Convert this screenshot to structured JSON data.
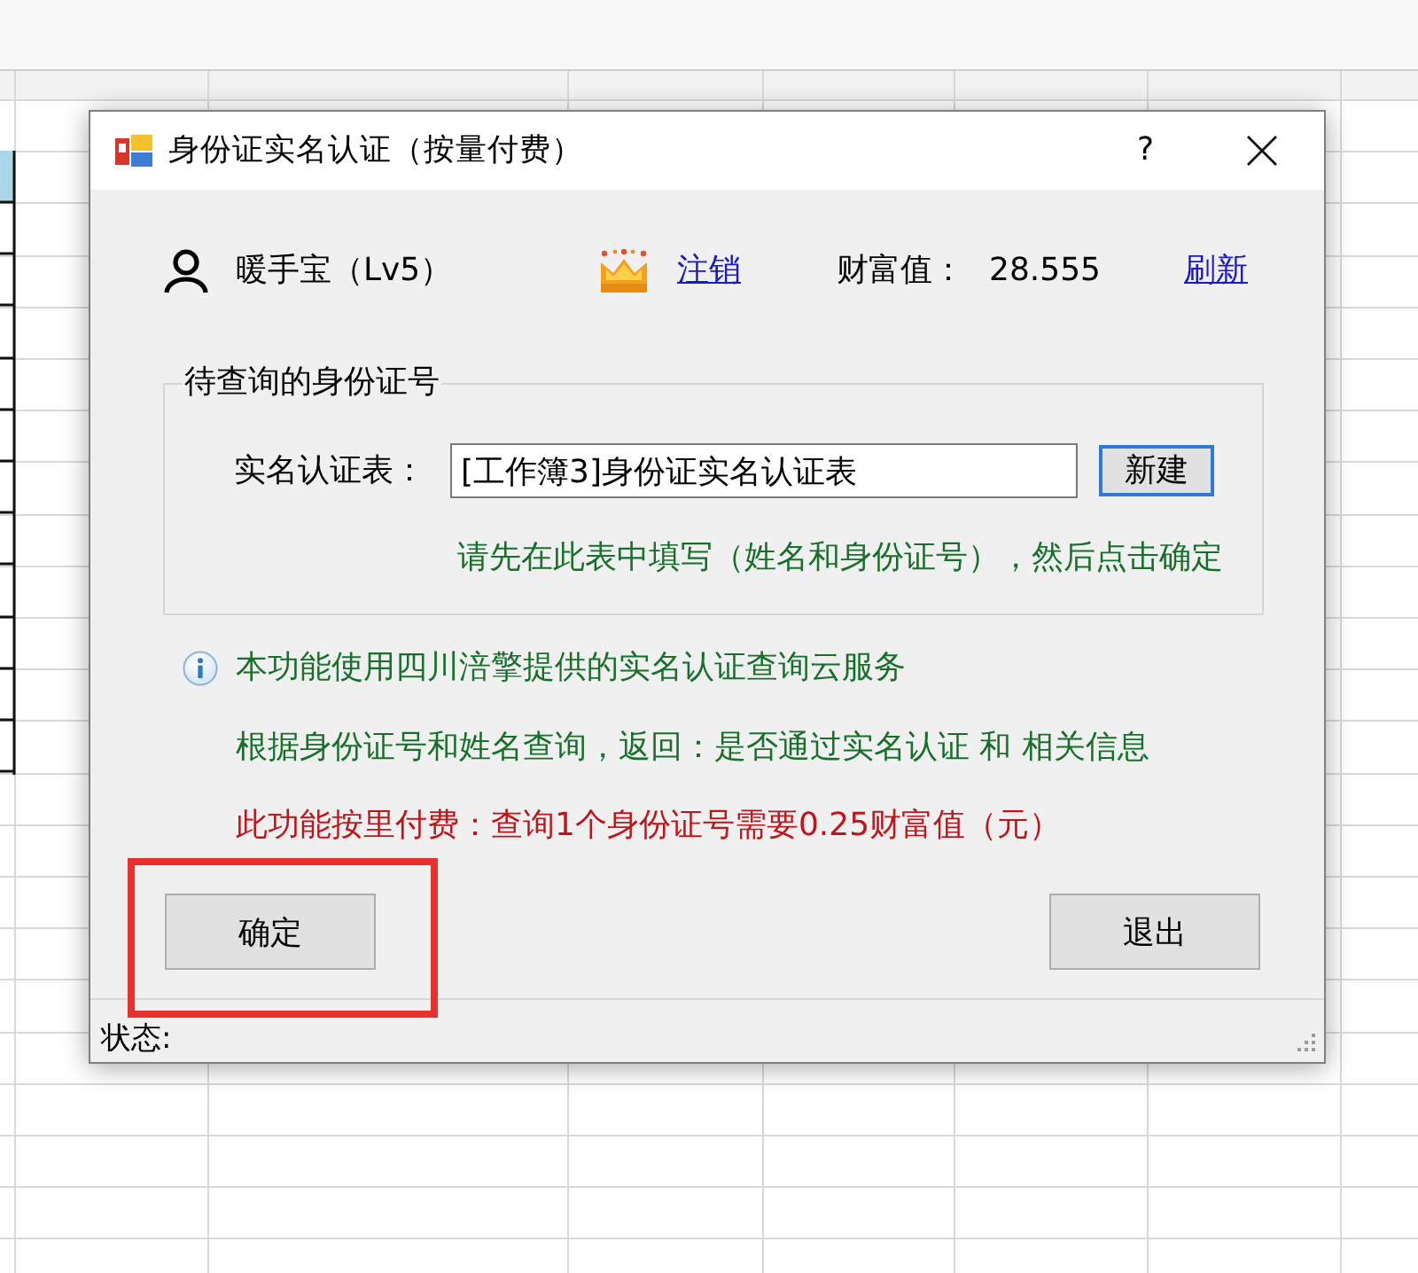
{
  "window": {
    "title": "身份证实名认证（按量付费）",
    "help_button": "?"
  },
  "user": {
    "name": "暖手宝（Lv5）",
    "logout_link": "注销",
    "wealth_label": "财富值：",
    "wealth_value": "28.555",
    "refresh_link": "刷新"
  },
  "query_group": {
    "title": "待查询的身份证号",
    "table_label": "实名认证表：",
    "table_field": {
      "value": "[工作簿3]身份证实名认证表"
    },
    "new_button": {
      "label": "新建",
      "focused": true
    },
    "hint": "请先在此表中填写（姓名和身份证号），然后点击确定"
  },
  "notes": [
    {
      "kind": "info",
      "text": "本功能使用四川涪擎提供的实名认证查询云服务"
    },
    {
      "kind": "detail",
      "text": "根据身份证号和姓名查询，返回：是否通过实名认证 和 相关信息"
    },
    {
      "kind": "pricing",
      "text": "此功能按里付费：查询1个身份证号需要0.25财富值（元）"
    }
  ],
  "buttons": [
    {
      "label": "确定",
      "highlighted": true
    },
    {
      "label": "退出",
      "highlighted": false
    }
  ],
  "status_bar": {
    "label": "状态:"
  }
}
